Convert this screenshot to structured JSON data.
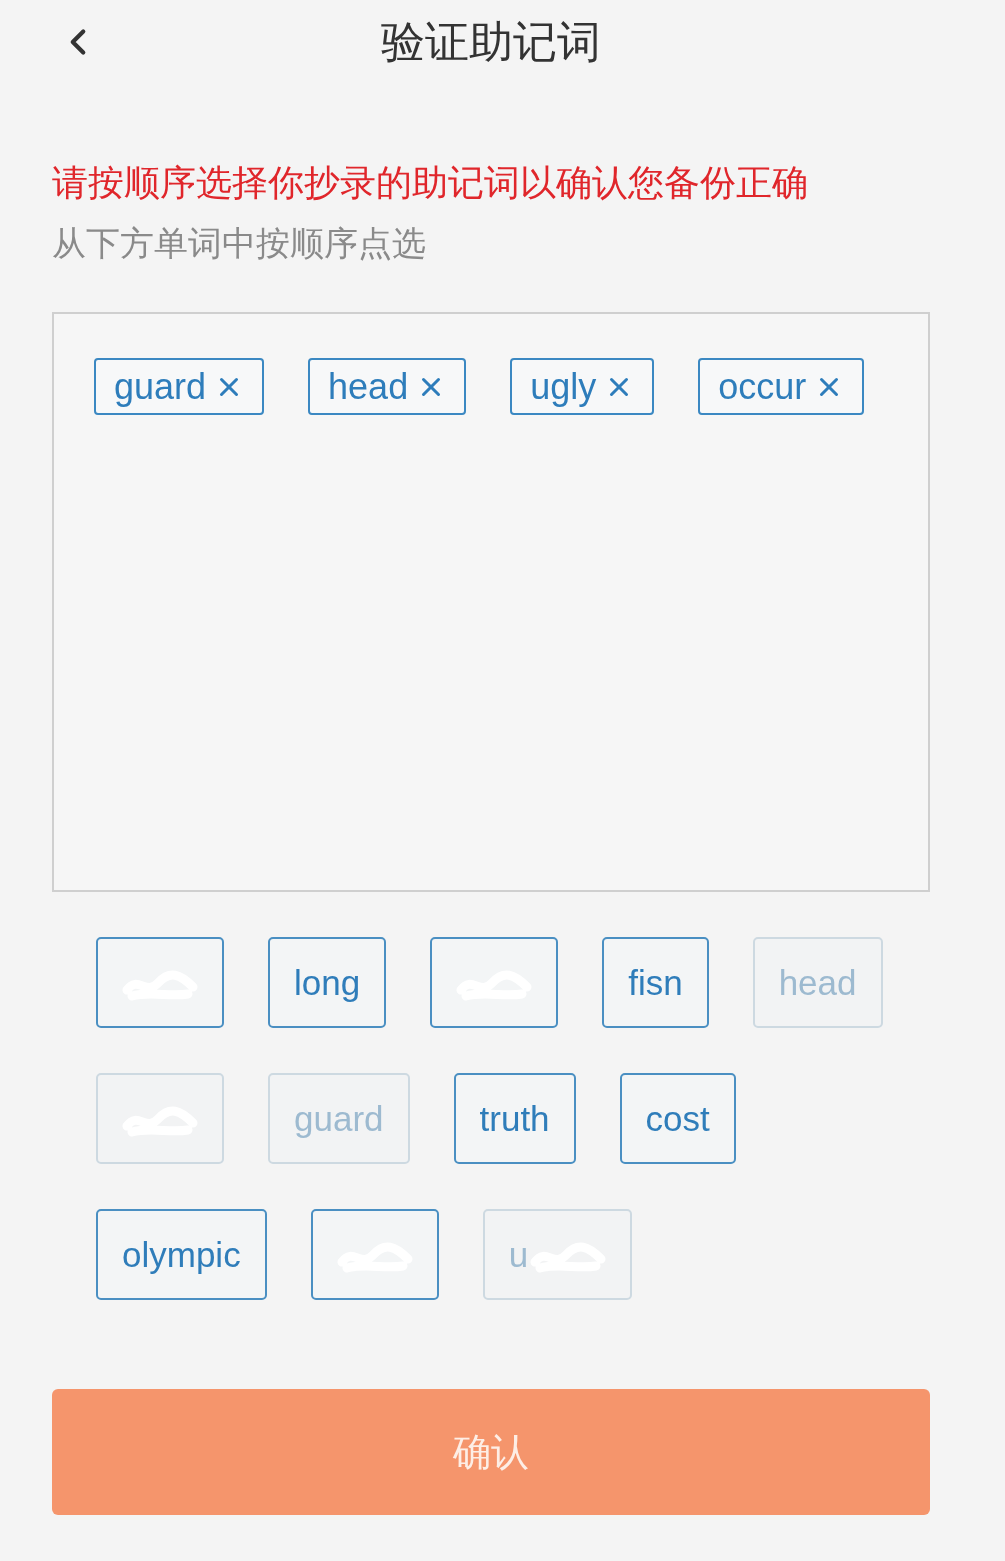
{
  "header": {
    "title": "验证助记词"
  },
  "instruction": "请按顺序选择你抄录的助记词以确认您备份正确",
  "hint": "从下方单词中按顺序点选",
  "selected_words": [
    {
      "text": "guard"
    },
    {
      "text": "head"
    },
    {
      "text": "ugly"
    },
    {
      "text": "occur"
    }
  ],
  "word_choices": [
    {
      "used": false,
      "redacted": true
    },
    {
      "text": "long",
      "used": false,
      "redacted": false
    },
    {
      "used": false,
      "redacted": true
    },
    {
      "text": "fisn",
      "used": false,
      "redacted": false
    },
    {
      "text": "head",
      "used": true,
      "redacted": false
    },
    {
      "used": true,
      "redacted": true
    },
    {
      "text": "guard",
      "used": true,
      "redacted": false
    },
    {
      "text": "truth",
      "used": false,
      "redacted": false
    },
    {
      "text": "cost",
      "used": false,
      "redacted": false
    },
    {
      "text": "olympic",
      "used": false,
      "redacted": false
    },
    {
      "used": false,
      "redacted": true
    },
    {
      "text": "u",
      "used": true,
      "redacted": true
    }
  ],
  "confirm_button": {
    "label": "确认",
    "disabled": true
  }
}
